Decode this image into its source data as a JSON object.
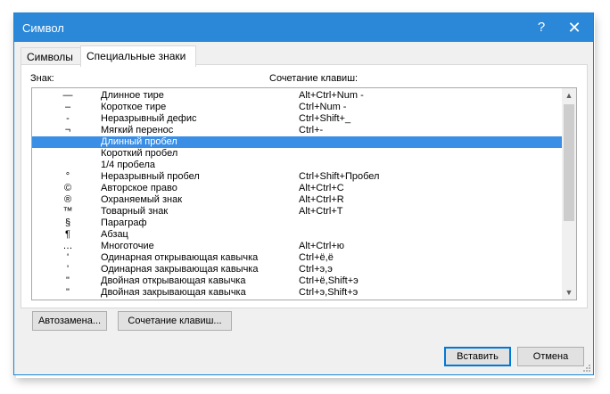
{
  "window": {
    "title": "Символ",
    "help_label": "?",
    "close_label": "✕"
  },
  "tabs": [
    {
      "label": "Символы"
    },
    {
      "label": "Специальные знаки"
    }
  ],
  "table": {
    "col_char": "Знак:",
    "col_shortcut": "Сочетание клавиш:",
    "rows": [
      {
        "sym": "—",
        "name": "Длинное тире",
        "key": "Alt+Ctrl+Num -"
      },
      {
        "sym": "–",
        "name": "Короткое тире",
        "key": "Ctrl+Num -"
      },
      {
        "sym": "-",
        "name": "Неразрывный дефис",
        "key": "Ctrl+Shift+_"
      },
      {
        "sym": "¬",
        "name": "Мягкий перенос",
        "key": "Ctrl+-"
      },
      {
        "sym": "",
        "name": "Длинный пробел",
        "key": ""
      },
      {
        "sym": "",
        "name": "Короткий пробел",
        "key": ""
      },
      {
        "sym": "",
        "name": "1/4 пробела",
        "key": ""
      },
      {
        "sym": "°",
        "name": "Неразрывный пробел",
        "key": "Ctrl+Shift+Пробел"
      },
      {
        "sym": "©",
        "name": "Авторское право",
        "key": "Alt+Ctrl+C"
      },
      {
        "sym": "®",
        "name": "Охраняемый знак",
        "key": "Alt+Ctrl+R"
      },
      {
        "sym": "™",
        "name": "Товарный знак",
        "key": "Alt+Ctrl+T"
      },
      {
        "sym": "§",
        "name": "Параграф",
        "key": ""
      },
      {
        "sym": "¶",
        "name": "Абзац",
        "key": ""
      },
      {
        "sym": "…",
        "name": "Многоточие",
        "key": "Alt+Ctrl+ю"
      },
      {
        "sym": "'",
        "name": "Одинарная открывающая кавычка",
        "key": "Ctrl+ё,ё"
      },
      {
        "sym": "'",
        "name": "Одинарная закрывающая кавычка",
        "key": "Ctrl+э,э"
      },
      {
        "sym": "\"",
        "name": "Двойная открывающая кавычка",
        "key": "Ctrl+ё,Shift+э"
      },
      {
        "sym": "\"",
        "name": "Двойная закрывающая кавычка",
        "key": "Ctrl+э,Shift+э"
      }
    ],
    "selected_index": 4
  },
  "buttons": {
    "autocorrect": "Автозамена...",
    "shortcut": "Сочетание клавиш...",
    "insert": "Вставить",
    "cancel": "Отмена"
  },
  "icons": {
    "scroll_up": "chevron-up-icon",
    "scroll_down": "chevron-down-icon",
    "resize": "resize-grip-icon"
  },
  "colors": {
    "titlebar": "#2b88d8",
    "selection": "#3a8ee6",
    "default_button_border": "#0078d7"
  }
}
